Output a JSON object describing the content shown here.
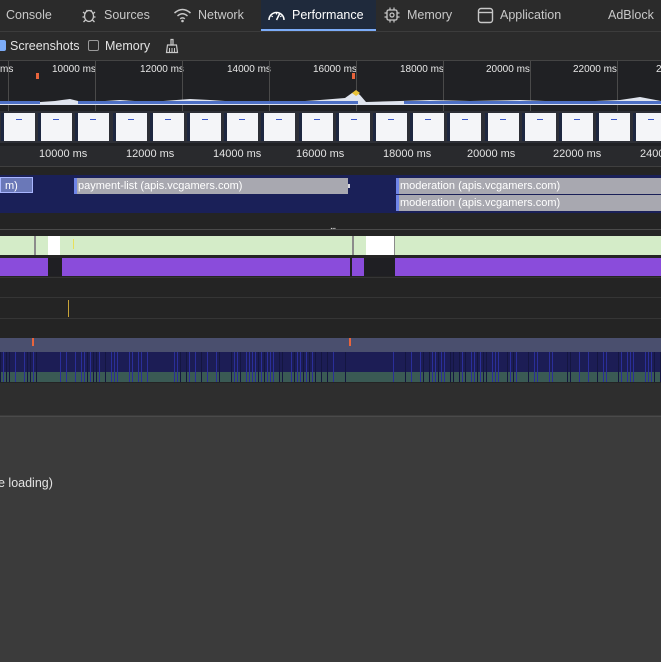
{
  "tabs": [
    {
      "label": "Console",
      "icon": "none"
    },
    {
      "label": "Sources",
      "icon": "bug-icon"
    },
    {
      "label": "Network",
      "icon": "wifi-icon"
    },
    {
      "label": "Performance",
      "icon": "gauge-icon",
      "active": true
    },
    {
      "label": "Memory",
      "icon": "chip-icon"
    },
    {
      "label": "Application",
      "icon": "window-icon"
    },
    {
      "label": "AdBlock",
      "icon": "none"
    }
  ],
  "toolbar": {
    "screenshots_label": "Screenshots",
    "screenshots_checked": true,
    "memory_label": "Memory",
    "memory_checked": false,
    "gc_icon": "broom-icon"
  },
  "overview": {
    "ticks": [
      "ms",
      "10000 ms",
      "12000 ms",
      "14000 ms",
      "16000 ms",
      "18000 ms",
      "20000 ms",
      "22000 ms",
      "2"
    ]
  },
  "timeline": {
    "ticks": [
      "10000 ms",
      "12000 ms",
      "14000 ms",
      "16000 ms",
      "18000 ms",
      "20000 ms",
      "22000 ms",
      "2400"
    ]
  },
  "network": {
    "requests": [
      {
        "label": "m)"
      },
      {
        "label": "payment-list (apis.vcgamers.com)"
      },
      {
        "label": "moderation (apis.vcgamers.com)"
      },
      {
        "label": "moderation (apis.vcgamers.com)"
      }
    ],
    "ellipsis": "..."
  },
  "summary": {
    "text": "e loading)"
  },
  "colors": {
    "accent": "#7cacf8",
    "network_track_bg": "#1a2058",
    "request_bar": "#a8a8b0",
    "frames_track": "#d4ecc8",
    "scripting": "#8a4cdb",
    "tasks_bg": "#1c1d55"
  }
}
